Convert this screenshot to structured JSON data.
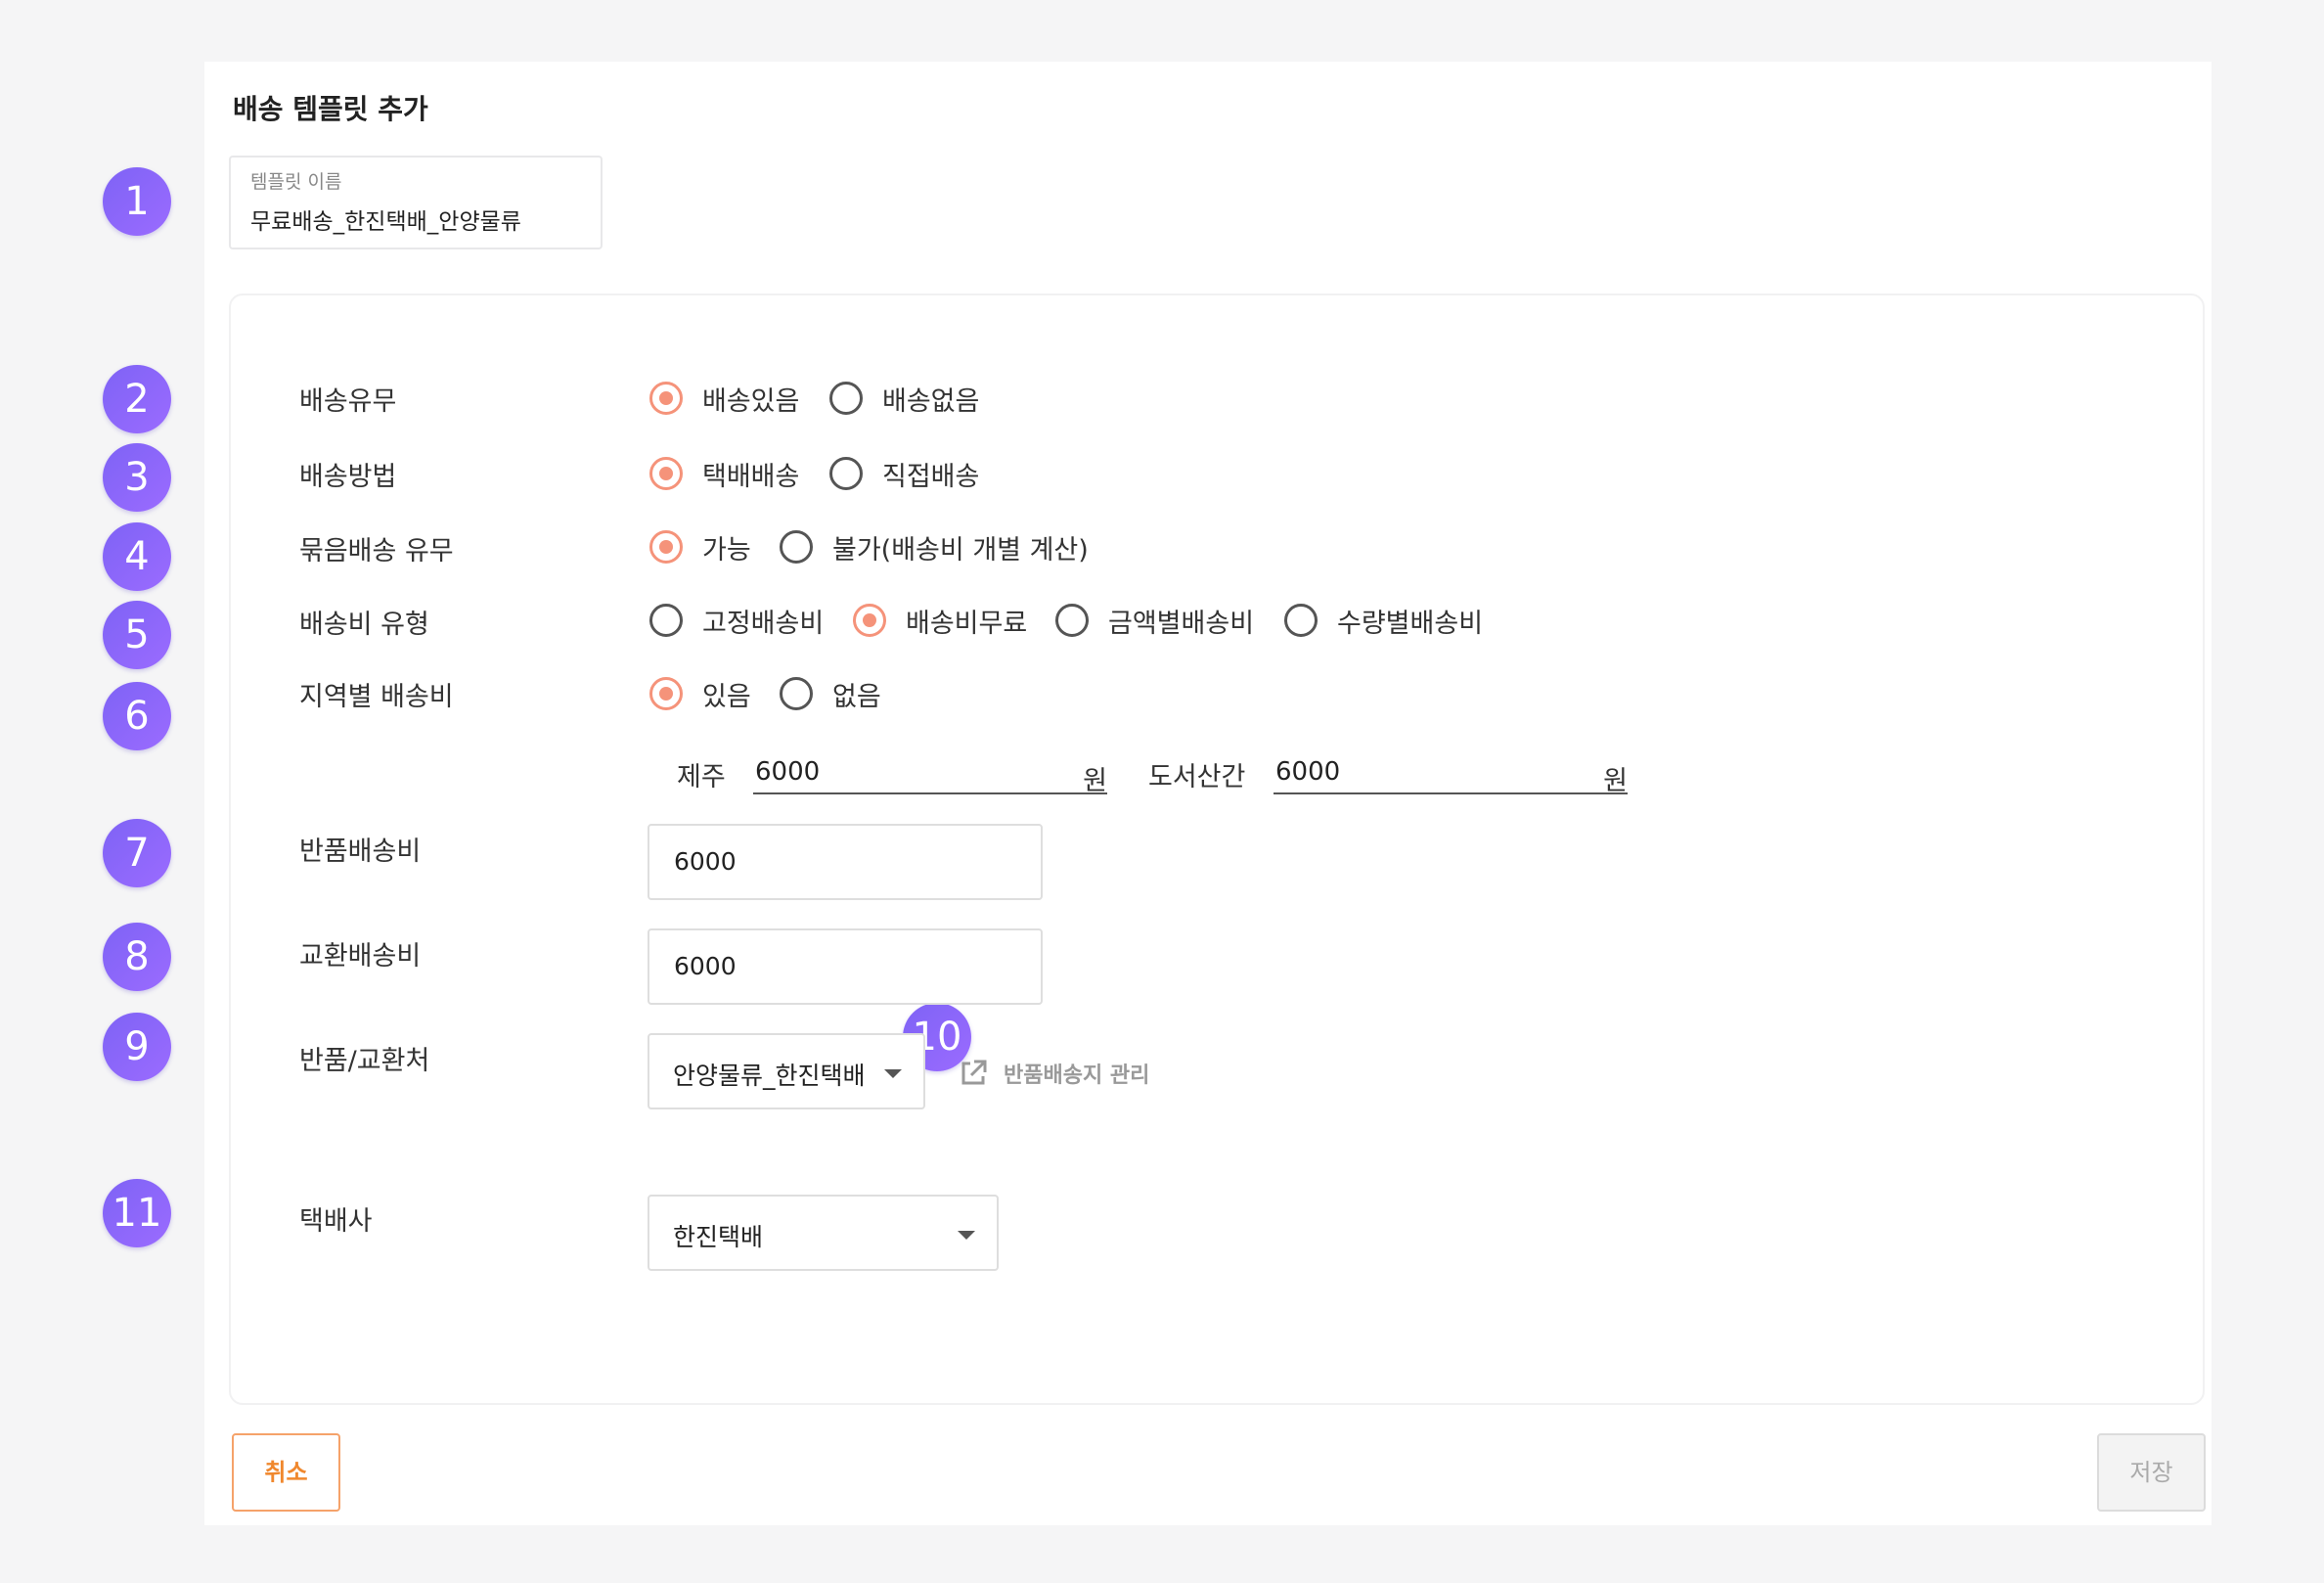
{
  "page": {
    "title": "배송 템플릿 추가"
  },
  "template_name": {
    "label": "템플릿 이름",
    "value": "무료배송_한진택배_안양물류"
  },
  "markers": [
    "1",
    "2",
    "3",
    "4",
    "5",
    "6",
    "7",
    "8",
    "9",
    "10",
    "11"
  ],
  "shipping_availability": {
    "label": "배송유무",
    "options": [
      {
        "label": "배송있음",
        "selected": true
      },
      {
        "label": "배송없음",
        "selected": false
      }
    ]
  },
  "shipping_method": {
    "label": "배송방법",
    "options": [
      {
        "label": "택배배송",
        "selected": true
      },
      {
        "label": "직접배송",
        "selected": false
      }
    ]
  },
  "bundle_shipping": {
    "label": "묶음배송 유무",
    "options": [
      {
        "label": "가능",
        "selected": true
      },
      {
        "label": "불가(배송비 개별 계산)",
        "selected": false
      }
    ]
  },
  "fee_type": {
    "label": "배송비 유형",
    "options": [
      {
        "label": "고정배송비",
        "selected": false
      },
      {
        "label": "배송비무료",
        "selected": true
      },
      {
        "label": "금액별배송비",
        "selected": false
      },
      {
        "label": "수량별배송비",
        "selected": false
      }
    ]
  },
  "regional_fee": {
    "label": "지역별 배송비",
    "options": [
      {
        "label": "있음",
        "selected": true
      },
      {
        "label": "없음",
        "selected": false
      }
    ],
    "jeju": {
      "label": "제주",
      "value": "6000",
      "unit": "원"
    },
    "islands": {
      "label": "도서산간",
      "value": "6000",
      "unit": "원"
    }
  },
  "return_fee": {
    "label": "반품배송비",
    "value": "6000"
  },
  "exchange_fee": {
    "label": "교환배송비",
    "value": "6000"
  },
  "return_address": {
    "label": "반품/교환처",
    "value": "안양물류_한진택배",
    "link_label": "반품배송지 관리"
  },
  "courier": {
    "label": "택배사",
    "value": "한진택배"
  },
  "actions": {
    "cancel": "취소",
    "save": "저장"
  },
  "colors": {
    "accent_radio": "#f5937a",
    "marker": "#8b67f8",
    "cancel": "#f0882e"
  }
}
